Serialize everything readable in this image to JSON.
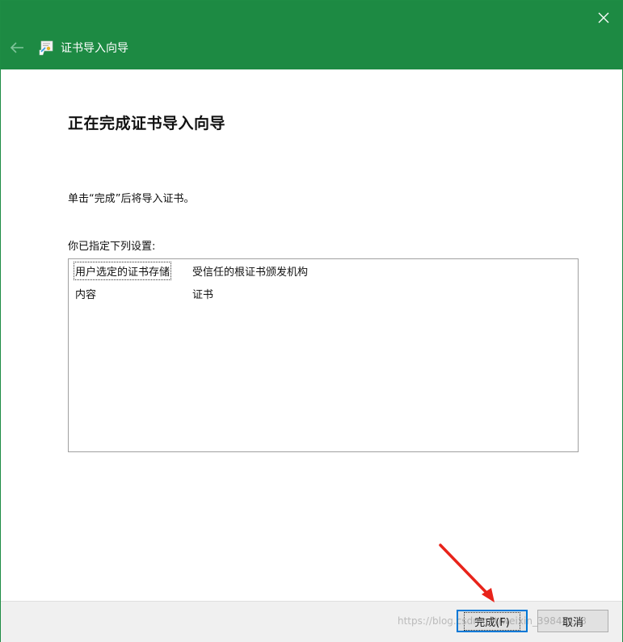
{
  "window": {
    "title": "证书导入向导",
    "close_glyph": "✕",
    "back_glyph": "←"
  },
  "page": {
    "heading": "正在完成证书导入向导",
    "instruction": "单击“完成”后将导入证书。",
    "settings_label": "你已指定下列设置:",
    "settings": [
      {
        "name": "用户选定的证书存储",
        "value": "受信任的根证书颁发机构"
      },
      {
        "name": "内容",
        "value": "证书"
      }
    ]
  },
  "footer": {
    "finish_label": "完成(F)",
    "cancel_label": "取消"
  },
  "watermark": "https://blog.csdn.net/weixin_39844113",
  "colors": {
    "titlebar": "#1d8a43",
    "focus_border": "#0078d7",
    "annotation_arrow": "#e8231a"
  }
}
